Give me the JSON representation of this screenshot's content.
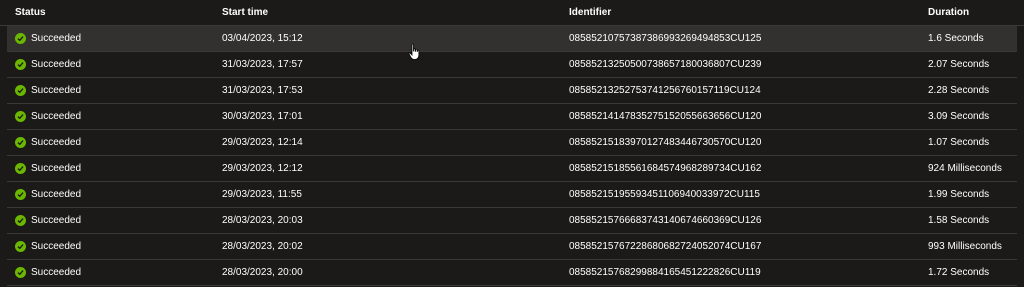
{
  "columns": {
    "status": "Status",
    "start_time": "Start time",
    "identifier": "Identifier",
    "duration": "Duration"
  },
  "rows": [
    {
      "status": "Succeeded",
      "start_time": "03/04/2023, 15:12",
      "identifier": "08585210757387386993269494853CU125",
      "duration": "1.6 Seconds"
    },
    {
      "status": "Succeeded",
      "start_time": "31/03/2023, 17:57",
      "identifier": "08585213250500738657180036807CU239",
      "duration": "2.07 Seconds"
    },
    {
      "status": "Succeeded",
      "start_time": "31/03/2023, 17:53",
      "identifier": "08585213252753741256760157119CU124",
      "duration": "2.28 Seconds"
    },
    {
      "status": "Succeeded",
      "start_time": "30/03/2023, 17:01",
      "identifier": "08585214147835275152055663656CU120",
      "duration": "3.09 Seconds"
    },
    {
      "status": "Succeeded",
      "start_time": "29/03/2023, 12:14",
      "identifier": "08585215183970127483446730570CU120",
      "duration": "1.07 Seconds"
    },
    {
      "status": "Succeeded",
      "start_time": "29/03/2023, 12:12",
      "identifier": "08585215185561684574968289734CU162",
      "duration": "924 Milliseconds"
    },
    {
      "status": "Succeeded",
      "start_time": "29/03/2023, 11:55",
      "identifier": "08585215195593451106940033972CU115",
      "duration": "1.99 Seconds"
    },
    {
      "status": "Succeeded",
      "start_time": "28/03/2023, 20:03",
      "identifier": "08585215766683743140674660369CU126",
      "duration": "1.58 Seconds"
    },
    {
      "status": "Succeeded",
      "start_time": "28/03/2023, 20:02",
      "identifier": "08585215767228680682724052074CU167",
      "duration": "993 Milliseconds"
    },
    {
      "status": "Succeeded",
      "start_time": "28/03/2023, 20:00",
      "identifier": "08585215768299884165451222826CU119",
      "duration": "1.72 Seconds"
    }
  ],
  "icons": {
    "status": "check-circle-icon",
    "cursor": "hand-pointer-icon"
  },
  "colors": {
    "background": "#1b1a19",
    "row_hover": "#323130",
    "divider": "#3b3a39",
    "success": "#6bb700"
  }
}
